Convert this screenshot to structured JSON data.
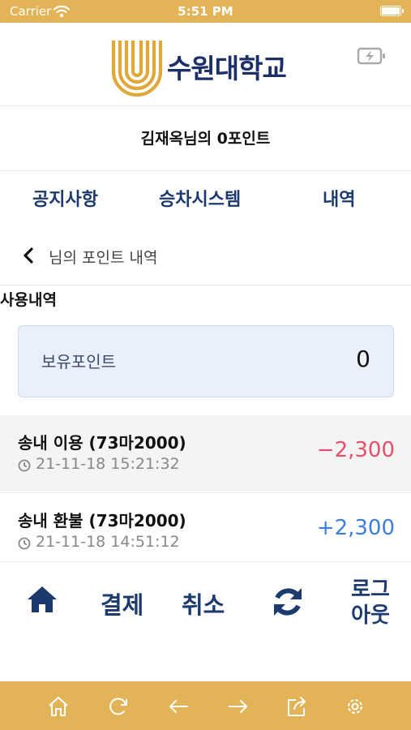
{
  "status_bar": {
    "carrier": "Carrier",
    "time": "5:51 PM"
  },
  "header": {
    "logo_text": "수원대학교",
    "brand_color": "#e0a83a",
    "text_color": "#1c2f66"
  },
  "points_title": "김재옥님의 0포인트",
  "tabs": [
    {
      "label": "공지사항"
    },
    {
      "label": "승차시스템"
    },
    {
      "label": "내역"
    }
  ],
  "subnav": {
    "label": "님의 포인트 내역"
  },
  "section_title": "사용내역",
  "balance": {
    "label": "보유포인트",
    "value": "0"
  },
  "transactions": [
    {
      "title": "송내 이용 (73마2000)",
      "time": "21-11-18 15:21:32",
      "amount": "−2,300",
      "kind": "debit"
    },
    {
      "title": "송내 환불 (73마2000)",
      "time": "21-11-18 14:51:12",
      "amount": "+2,300",
      "kind": "credit"
    }
  ],
  "toolbar": {
    "home_icon": "home-icon",
    "pay_label": "결제",
    "cancel_label": "취소",
    "refresh_icon": "refresh-icon",
    "logout_line1": "로그",
    "logout_line2": "아웃"
  },
  "browser_bar": {
    "icons": [
      "home-icon",
      "reload-icon",
      "back-arrow-icon",
      "forward-arrow-icon",
      "share-icon",
      "settings-icon"
    ],
    "color": "#e2b357"
  }
}
